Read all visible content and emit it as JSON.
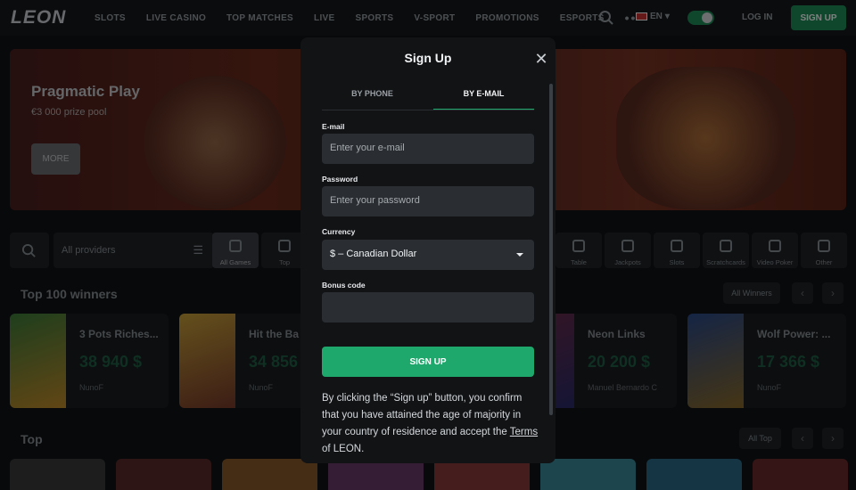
{
  "header": {
    "logo": "LEON",
    "nav": [
      "SLOTS",
      "LIVE CASINO",
      "TOP MATCHES",
      "LIVE",
      "SPORTS",
      "V-SPORT",
      "PROMOTIONS",
      "ESPORTS",
      "•••"
    ],
    "lang": "EN",
    "login": "LOG IN",
    "signup": "SIGN UP"
  },
  "banner": {
    "title": "Pragmatic Play",
    "subtitle": "€3 000 prize pool",
    "button": "MORE"
  },
  "filters": {
    "providers": "All providers",
    "categories": [
      "All Games",
      "Top",
      "Table",
      "Jackpots",
      "Slots",
      "Scratchcards",
      "Video Poker",
      "Other"
    ]
  },
  "winners": {
    "title": "Top 100 winners",
    "all_button": "All Winners",
    "items": [
      {
        "name": "3 Pots Riches...",
        "amount": "38 940 $",
        "user": "NunoF"
      },
      {
        "name": "Hit the Ba",
        "amount": "34 856",
        "user": "NunoF"
      },
      {
        "name": "Neon Links",
        "amount": "20 200 $",
        "user": "Manuel Bernardo C"
      },
      {
        "name": "Wolf Power: ...",
        "amount": "17 366 $",
        "user": "NunoF"
      }
    ]
  },
  "top": {
    "title": "Top",
    "all_button": "All Top"
  },
  "modal": {
    "title": "Sign Up",
    "tab_phone": "BY PHONE",
    "tab_email": "BY E-MAIL",
    "email_label": "E-mail",
    "email_placeholder": "Enter your e-mail",
    "password_label": "Password",
    "password_placeholder": "Enter your password",
    "currency_label": "Currency",
    "currency_value": "$ – Canadian Dollar",
    "bonus_label": "Bonus code",
    "bonus_value": "",
    "submit": "SIGN UP",
    "terms_text": "By clicking the “Sign up” button, you confirm that you have attained the age of majority in your country of residence and accept the",
    "terms_link": "Terms",
    "terms_end": "of LEON.",
    "close_icon": "close-icon"
  },
  "colors": {
    "accent": "#1fa86c",
    "background": "#101214",
    "modal": "#111315"
  }
}
